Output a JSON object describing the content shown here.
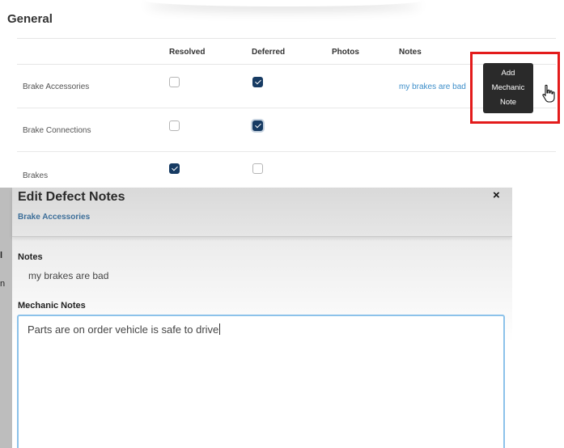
{
  "section": {
    "title": "General"
  },
  "table": {
    "columns": [
      "Resolved",
      "Deferred",
      "Photos",
      "Notes"
    ],
    "rows": [
      {
        "label": "Brake Accessories",
        "resolved": false,
        "deferred": true,
        "note": "my brakes are bad"
      },
      {
        "label": "Brake Connections",
        "resolved": false,
        "deferred": true,
        "note": ""
      },
      {
        "label": "Brakes",
        "resolved": true,
        "deferred": false,
        "note": ""
      }
    ]
  },
  "tooltip": {
    "lines": [
      "Add",
      "Mechanic",
      "Note"
    ]
  },
  "backdrop": {
    "fragments": [
      "l",
      "n"
    ]
  },
  "modal": {
    "title": "Edit Defect Notes",
    "subtitle": "Brake Accessories",
    "close": "×",
    "notes_label": "Notes",
    "notes_value": "my brakes are bad",
    "mechanic_label": "Mechanic Notes",
    "mechanic_value": "Parts are on order vehicle is safe to drive"
  },
  "colors": {
    "accent": "#173b63",
    "link": "#3d8ec9",
    "highlight": "#e31b1b",
    "focus_border": "#8cc2ea"
  }
}
